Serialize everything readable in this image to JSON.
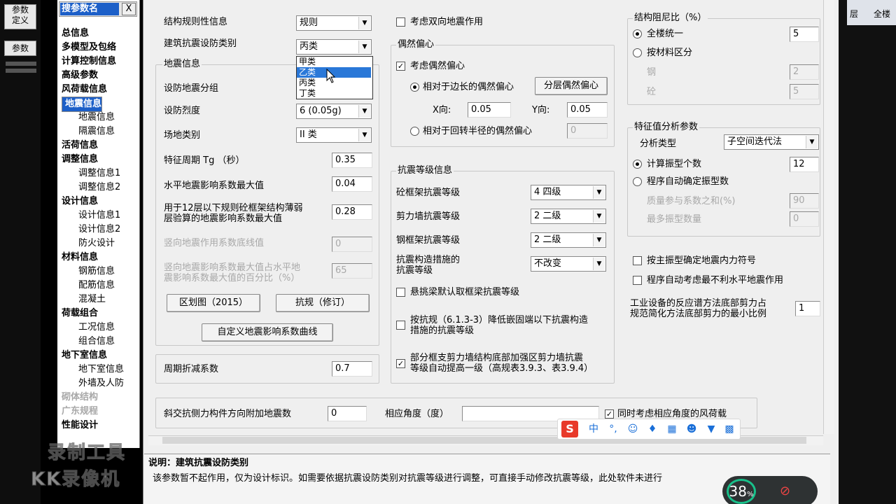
{
  "left_bar": {
    "btn1": "参数",
    "btn2": "定义",
    "btn3": "参数"
  },
  "tree": {
    "title": "搜参数名",
    "close": "X",
    "items": [
      {
        "label": "总信息",
        "level": 1
      },
      {
        "label": "多模型及包络",
        "level": 1
      },
      {
        "label": "计算控制信息",
        "level": 1
      },
      {
        "label": "高级参数",
        "level": 1
      },
      {
        "label": "风荷载信息",
        "level": 1
      },
      {
        "label": "地震信息",
        "level": 1,
        "selected": true
      },
      {
        "label": "地震信息",
        "level": 2
      },
      {
        "label": "隔震信息",
        "level": 2
      },
      {
        "label": "活荷信息",
        "level": 1
      },
      {
        "label": "调整信息",
        "level": 1
      },
      {
        "label": "调整信息1",
        "level": 2
      },
      {
        "label": "调整信息2",
        "level": 2
      },
      {
        "label": "设计信息",
        "level": 1
      },
      {
        "label": "设计信息1",
        "level": 2
      },
      {
        "label": "设计信息2",
        "level": 2
      },
      {
        "label": "防火设计",
        "level": 2
      },
      {
        "label": "材料信息",
        "level": 1
      },
      {
        "label": "钢筋信息",
        "level": 2
      },
      {
        "label": "配筋信息",
        "level": 2
      },
      {
        "label": "混凝土",
        "level": 2
      },
      {
        "label": "荷载组合",
        "level": 1
      },
      {
        "label": "工况信息",
        "level": 2
      },
      {
        "label": "组合信息",
        "level": 2
      },
      {
        "label": "地下室信息",
        "level": 1
      },
      {
        "label": "地下室信息",
        "level": 2
      },
      {
        "label": "外墙及人防",
        "level": 2
      },
      {
        "label": "砌体结构",
        "level": 1,
        "disabled": true
      },
      {
        "label": "广东规程",
        "level": 1,
        "disabled": true
      },
      {
        "label": "性能设计",
        "level": 1
      }
    ]
  },
  "form": {
    "regularity_label": "结构规则性信息",
    "regularity_value": "规则",
    "category_label": "建筑抗震设防类别",
    "category_value": "丙类",
    "category_options": [
      "甲类",
      "乙类",
      "丙类",
      "丁类"
    ],
    "quake_group_title": "地震信息",
    "group_label": "设防地震分组",
    "intensity_label": "设防烈度",
    "intensity_value": "6 (0.05g)",
    "site_label": "场地类别",
    "site_value": "II 类",
    "tg_label": "特征周期 Tg （秒）",
    "tg_value": "0.35",
    "amax_label": "水平地震影响系数最大值",
    "amax_value": "0.04",
    "frame12_label_1": "用于12层以下规则砼框架结构薄弱",
    "frame12_label_2": "层验算的地震影响系数最大值",
    "frame12_value": "0.28",
    "vert_label": "竖向地震作用系数底线值",
    "vert_value": "0",
    "vert_ratio_label_1": "竖向地震影响系数最大值占水平地",
    "vert_ratio_label_2": "震影响系数最大值的百分比（%）",
    "vert_ratio_value": "65",
    "zoning_btn": "区划图（2015）",
    "code_btn": "抗规（修订）",
    "custom_curve_btn": "自定义地震影响系数曲线",
    "period_factor_label": "周期折减系数",
    "period_factor_value": "0.7",
    "oblique_label": "斜交抗侧力构件方向附加地震数",
    "oblique_value": "0",
    "angle_label": "相应角度（度）",
    "angle_value": "",
    "wind_angle_label": "同时考虑相应角度的风荷载"
  },
  "middle": {
    "bidir_label": "考虑双向地震作用",
    "ecc_title": "偶然偏心",
    "ecc_consider": "考虑偶然偏心",
    "ecc_edge": "相对于边长的偶然偏心",
    "ecc_layer_btn": "分层偶然偏心",
    "x_label": "X向:",
    "x_value": "0.05",
    "y_label": "Y向:",
    "y_value": "0.05",
    "ecc_radius": "相对于回转半径的偶然偏心",
    "ecc_radius_value": "0",
    "grade_title": "抗震等级信息",
    "concrete_frame_label": "砼框架抗震等级",
    "concrete_frame_value": "4  四级",
    "shear_wall_label": "剪力墙抗震等级",
    "shear_wall_value": "2  二级",
    "steel_frame_label": "钢框架抗震等级",
    "steel_frame_value": "2  二级",
    "measure_label_1": "抗震构造措施的",
    "measure_label_2": "抗震等级",
    "measure_value": "不改变",
    "cantilever_label": "悬挑梁默认取框梁抗震等级",
    "lower_label_1": "按抗规（6.1.3-3）降低嵌固端以下抗震构造",
    "lower_label_2": "措施的抗震等级",
    "partial_label_1": "部分框支剪力墙结构底部加强区剪力墙抗震",
    "partial_label_2": "等级自动提高一级（高规表3.9.3、表3.9.4）"
  },
  "right": {
    "damping_title": "结构阻尼比（%）",
    "uniform_label": "全楼统一",
    "uniform_value": "5",
    "by_material_label": "按材料区分",
    "steel_label": "钢",
    "steel_value": "2",
    "concrete_label": "砼",
    "concrete_value": "5",
    "eigen_title": "特征值分析参数",
    "analysis_type_label": "分析类型",
    "analysis_type_value": "子空间迭代法",
    "modes_label": "计算振型个数",
    "modes_value": "12",
    "auto_modes_label": "程序自动确定振型数",
    "mass_ratio_label": "质量参与系数之和(%)",
    "mass_ratio_value": "90",
    "max_modes_label": "最多振型数量",
    "max_modes_value": "0",
    "main_mode_sign": "按主振型确定地震内力符号",
    "auto_worst": "程序自动考虑最不利水平地震作用",
    "industrial_label_1": "工业设备的反应谱方法底部剪力占",
    "industrial_label_2": "规范简化方法底部剪力的最小比例",
    "industrial_value": "1"
  },
  "description": {
    "title": "说明：建筑抗震设防类别",
    "text": "该参数暂不起作用，仅为设计标识。如需要依据抗震设防类别对抗震等级进行调整，可直接手动修改抗震等级，此处软件未进行"
  },
  "ime": {
    "logo": "S",
    "lang": "中",
    "punct": "°,"
  },
  "watermark": {
    "line1": "录制工具",
    "line2": "KK录像机"
  },
  "network": {
    "percent": "38",
    "unit": "%"
  },
  "top_right": {
    "btn1": "层",
    "btn2": "全楼"
  }
}
